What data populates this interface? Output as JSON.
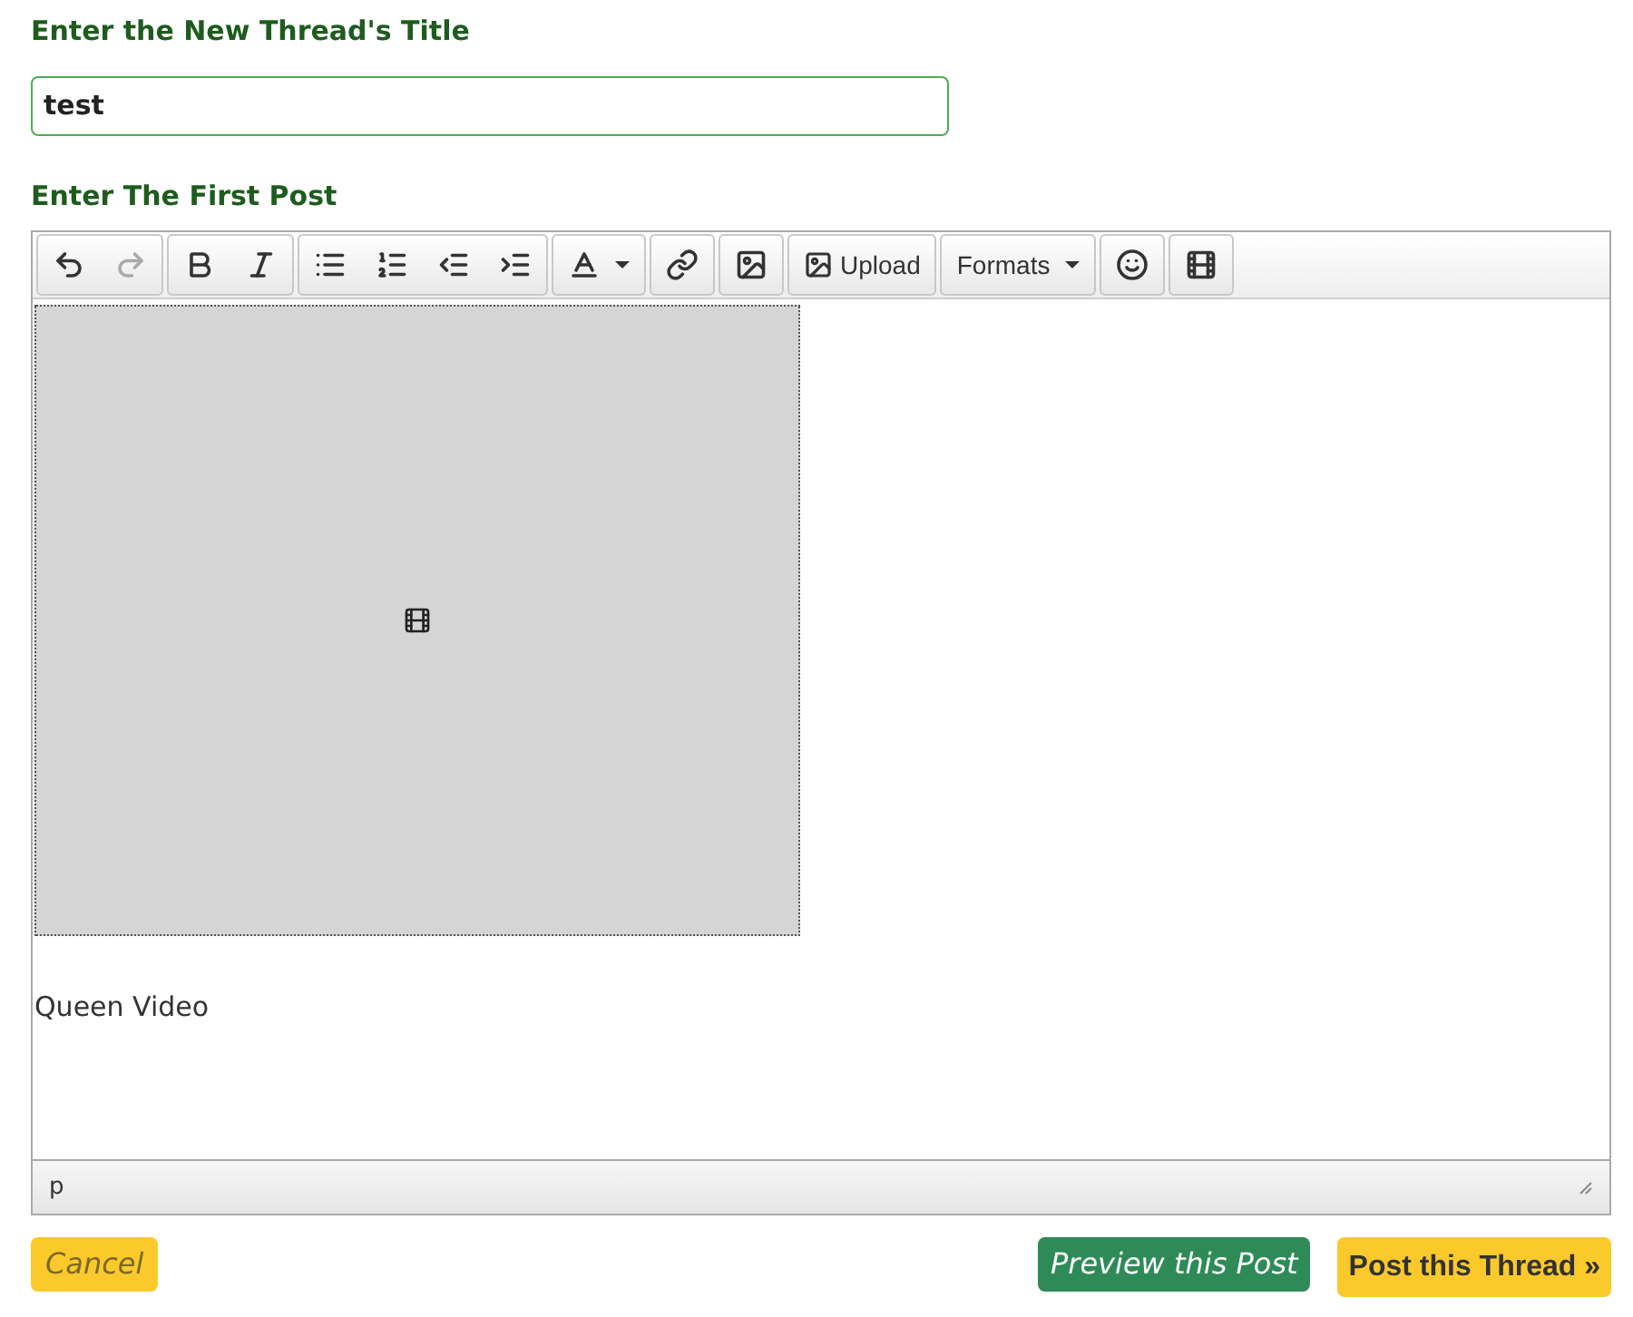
{
  "title_label": "Enter the New Thread's Title",
  "title_field": {
    "value": "test"
  },
  "post_label": "Enter The First Post",
  "toolbar": [
    {
      "buttons": [
        {
          "kind": "undo",
          "disabled": false
        },
        {
          "kind": "redo",
          "disabled": true
        }
      ]
    },
    {
      "buttons": [
        {
          "kind": "bold",
          "disabled": false
        },
        {
          "kind": "italic",
          "disabled": false
        }
      ]
    },
    {
      "buttons": [
        {
          "kind": "bullets",
          "disabled": false
        },
        {
          "kind": "numbers",
          "disabled": false
        },
        {
          "kind": "outdent",
          "disabled": false
        },
        {
          "kind": "indent",
          "disabled": false
        }
      ]
    },
    {
      "buttons": [
        {
          "kind": "textcolor",
          "disabled": false
        }
      ]
    },
    {
      "buttons": [
        {
          "kind": "link",
          "disabled": false
        }
      ]
    },
    {
      "buttons": [
        {
          "kind": "image",
          "disabled": false
        }
      ]
    },
    {
      "buttons": [
        {
          "kind": "upload",
          "label": "Upload",
          "disabled": false
        }
      ]
    },
    {
      "buttons": [
        {
          "kind": "formats",
          "label": "Formats",
          "disabled": false
        }
      ]
    },
    {
      "buttons": [
        {
          "kind": "emoji",
          "disabled": false
        }
      ]
    },
    {
      "buttons": [
        {
          "kind": "media",
          "disabled": false
        }
      ]
    }
  ],
  "content": [
    {
      "kind": "media"
    },
    {
      "kind": "paragraph",
      "text": "Queen Video"
    }
  ],
  "status_path": "p",
  "buttons": [
    {
      "kind": "cancel",
      "label": "Cancel"
    },
    {
      "kind": "preview",
      "label": "Preview this Post"
    },
    {
      "kind": "submit",
      "label": "Post this Thread »"
    }
  ]
}
